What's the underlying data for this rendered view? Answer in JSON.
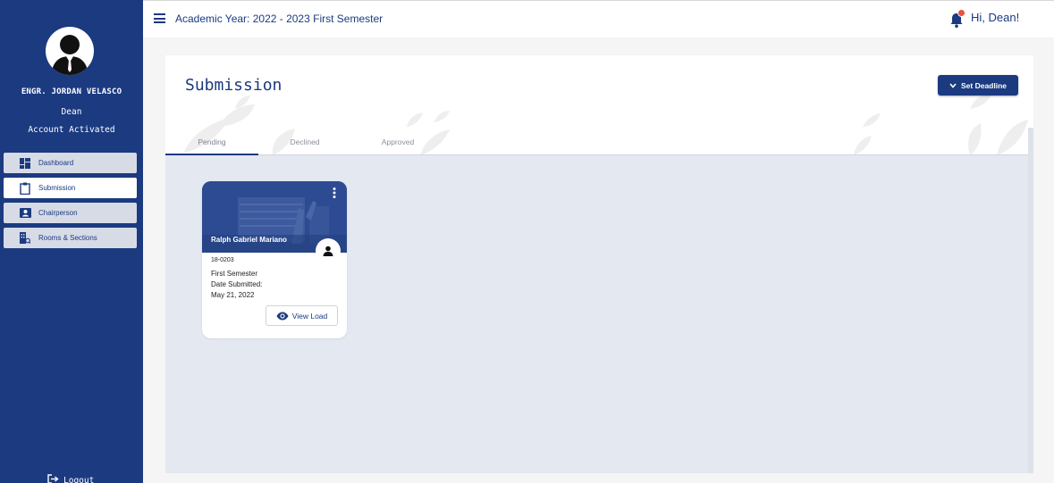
{
  "sidebar": {
    "user_name": "ENGR. JORDAN VELASCO",
    "user_role": "Dean",
    "account_status": "Account Activated",
    "items": [
      {
        "label": "Dashboard",
        "icon": "dashboard-icon"
      },
      {
        "label": "Submission",
        "icon": "clipboard-icon",
        "active": true
      },
      {
        "label": "Chairperson",
        "icon": "contact-card-icon"
      },
      {
        "label": "Rooms & Sections",
        "icon": "building-icon"
      }
    ],
    "logout_label": "Logout"
  },
  "topbar": {
    "academic_year": "Academic Year: 2022 - 2023 First Semester",
    "greeting": "Hi, Dean!"
  },
  "main": {
    "title": "Submission",
    "set_deadline_label": "Set Deadline",
    "tabs": [
      {
        "label": "Pending",
        "active": true
      },
      {
        "label": "Declined"
      },
      {
        "label": "Approved"
      }
    ],
    "submissions": [
      {
        "name": "Ralph Gabriel Mariano",
        "id": "18-0203",
        "semester": "First Semester",
        "date_label": "Date Submitted:",
        "date": "May 21, 2022",
        "view_label": "View Load"
      }
    ]
  },
  "colors": {
    "primary": "#1b3a80",
    "badge": "#e8543a",
    "content_bg": "#e4e8f0"
  }
}
